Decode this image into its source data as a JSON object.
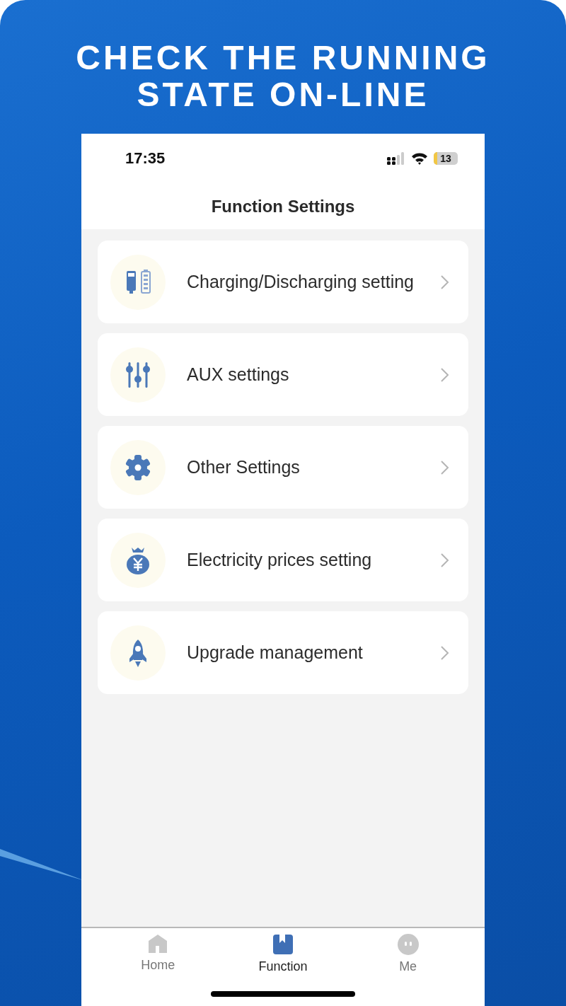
{
  "headline": [
    "CHECK THE RUNNING",
    "STATE ON-LINE"
  ],
  "status_bar": {
    "time": "17:35",
    "battery": "13"
  },
  "header": {
    "title": "Function Settings"
  },
  "menu": [
    {
      "kind": "battery",
      "label": "Charging/Discharging setting"
    },
    {
      "kind": "sliders",
      "label": "AUX settings"
    },
    {
      "kind": "gear",
      "label": "Other Settings"
    },
    {
      "kind": "moneybag",
      "label": "Electricity prices setting"
    },
    {
      "kind": "rocket",
      "label": "Upgrade management"
    }
  ],
  "tab_bar": [
    {
      "kind": "home",
      "label": "Home",
      "selected": false
    },
    {
      "kind": "book",
      "label": "Function",
      "selected": true
    },
    {
      "kind": "face",
      "label": "Me",
      "selected": false
    }
  ]
}
